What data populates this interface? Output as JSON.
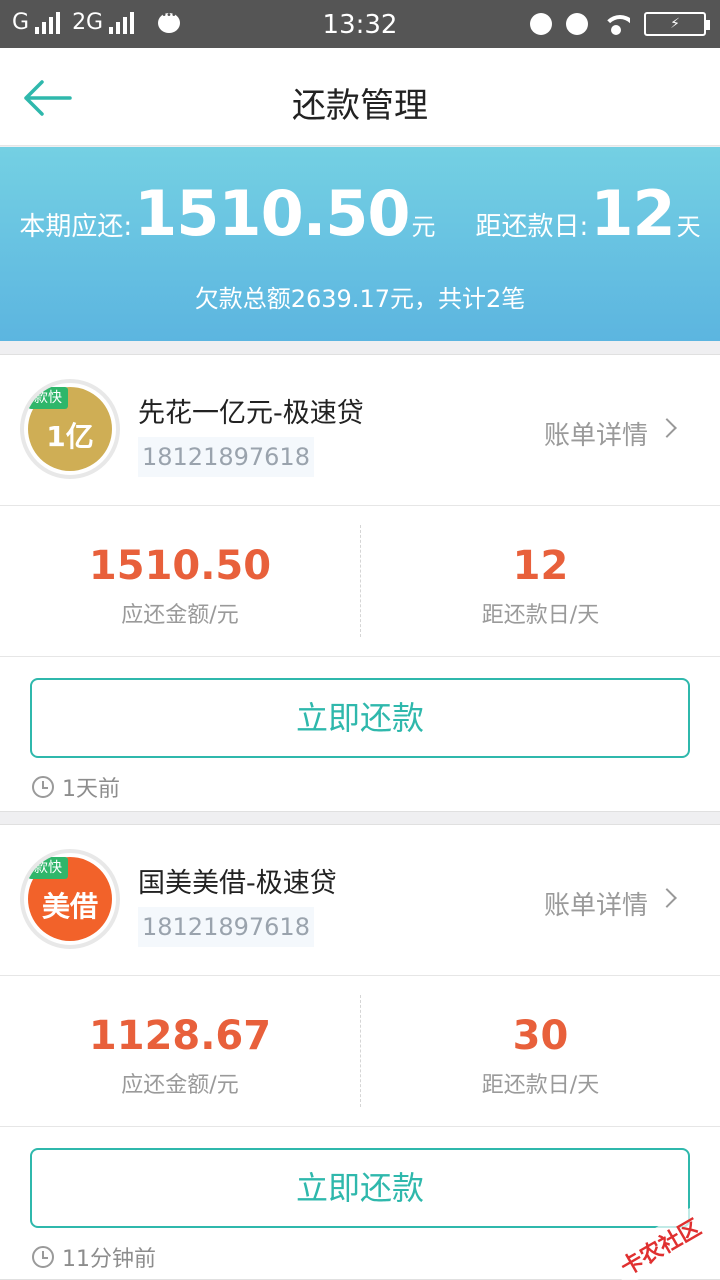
{
  "status_bar": {
    "left": "G",
    "network": "2G",
    "time": "13:32"
  },
  "header": {
    "title": "还款管理"
  },
  "summary": {
    "current_label": "本期应还:",
    "current_amount": "1510.50",
    "current_unit": "元",
    "days_label": "距还款日:",
    "days": "12",
    "days_unit": "天",
    "total_text": "欠款总额2639.17元，共计2笔"
  },
  "loans": [
    {
      "logo_tag": "款快",
      "logo_text": "1亿",
      "logo_color": "#cfae55",
      "name": "先花一亿元-极速贷",
      "phone": "18121897618",
      "detail_label": "账单详情",
      "amount": "1510.50",
      "amount_label": "应还金额/元",
      "days": "12",
      "days_label": "距还款日/天",
      "pay_label": "立即还款",
      "time_ago": "1天前"
    },
    {
      "logo_tag": "款快",
      "logo_text": "美借",
      "logo_color": "#f2622a",
      "name": "国美美借-极速贷",
      "phone": "18121897618",
      "detail_label": "账单详情",
      "amount": "1128.67",
      "amount_label": "应还金额/元",
      "days": "30",
      "days_label": "距还款日/天",
      "pay_label": "立即还款",
      "time_ago": "11分钟前"
    }
  ],
  "watermark": "卡农社区",
  "colors": {
    "accent": "#2fb8ac",
    "amount": "#e8603b",
    "banner_top": "#74d0e3",
    "banner_bottom": "#5cb5e0"
  }
}
